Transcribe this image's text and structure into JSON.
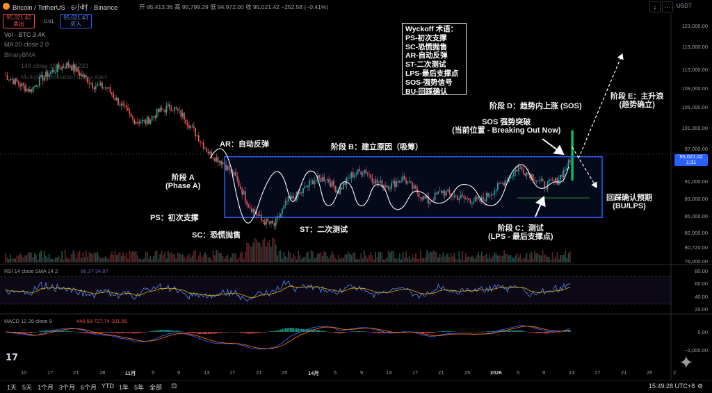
{
  "header": {
    "symbol": "Bitcoin / TetherUS · 6小时 · Binance",
    "ohlc": "开 95,413.36  高 95,799.29  低 94,972.00  收 95,021.42  −252.58 (−0.41%)",
    "sell_price": "95,021.42",
    "sell_label": "卖出",
    "spread": "0.01",
    "buy_price": "95,021.43",
    "buy_label": "买入",
    "quote_currency": "USDT"
  },
  "legends": {
    "volume": "Vol · BTC  3.4K",
    "ma": "MA 20 close 2 0",
    "bbma": "BinaryBMA",
    "ema": "144 close 169 close 233",
    "multi": "Multiple Correlation Cross Alert"
  },
  "wyckoff_legend": {
    "title": "Wyckoff 术语：",
    "items": [
      "PS-初次支撑",
      "SC-恐慌抛售",
      "AR-自动反弹",
      "ST-二次测试",
      "LPS-最后支撑点",
      "SOS-强势信号",
      "BU-回踩确认"
    ]
  },
  "annotations": {
    "ar": "AR：自动反弹",
    "phase_a_1": "阶段 A",
    "phase_a_2": "(Phase A)",
    "ps": "PS：初次支撑",
    "sc": "SC：恐慌抛售",
    "phase_b": "阶段 B：建立原因（吸筹）",
    "st": "ST：二次测试",
    "phase_c_1": "阶段 C：测试",
    "phase_c_2": "(LPS - 最后支撑点)",
    "phase_d": "阶段 D：趋势内上涨 (SOS)",
    "sos_1": "SOS 强势突破",
    "sos_2": "(当前位置 - Breaking Out Now)",
    "phase_e_1": "阶段 E：主升浪",
    "phase_e_2": "(趋势确立)",
    "bu_1": "回踩确认预期",
    "bu_2": "(BU/LPS)"
  },
  "price_axis": {
    "ticks": [
      "123,000.00",
      "119,000.00",
      "113,000.00",
      "109,000.00",
      "105,000.00",
      "101,000.00",
      "97,000.00",
      "91,000.00",
      "89,000.00",
      "85,000.00",
      "82,000.00",
      "80,720.00",
      "76,000.00"
    ],
    "last_price": "95,021.42",
    "countdown": "1:31"
  },
  "rsi": {
    "label": "RSI 14 close SMA 14 2",
    "values_text": "66.37  34.87",
    "ticks": [
      "80.00",
      "60.00",
      "40.00",
      "20.00"
    ]
  },
  "macd": {
    "label": "MACD 12 26 close 9",
    "values_text": "446.93  727.74  301.56",
    "ticks": [
      "0.00",
      "−2,000.00"
    ]
  },
  "time_axis": {
    "labels": [
      "10",
      "17",
      "21",
      "28",
      "11月",
      "5",
      "9",
      "13",
      "17",
      "21",
      "25",
      "14月",
      "5",
      "9",
      "13",
      "17",
      "21",
      "25",
      "2026",
      "5",
      "9",
      "13",
      "17",
      "21",
      "25",
      "2"
    ]
  },
  "bottom_bar": {
    "timeframes": [
      "1天",
      "5天",
      "1个月",
      "3个月",
      "6个月",
      "YTD",
      "1年",
      "5年",
      "全部"
    ],
    "clock": "15:49:28 UTC+8"
  },
  "colors": {
    "up": "#26a69a",
    "down": "#ef5350",
    "box": "#2962ff",
    "rsi": "#7e57c2",
    "macd": "#2962ff",
    "signal": "#ff6d00",
    "lps_line": "#2e7d32",
    "breakout": "#00c853"
  },
  "chart_data": {
    "type": "candlestick",
    "title": "Bitcoin / TetherUS · 6小时 · Binance",
    "x_range": [
      "10月10日",
      "2026年2月"
    ],
    "ylim": [
      76000,
      123000
    ],
    "last_close": 95021.42,
    "change": -252.58,
    "change_pct": -0.41,
    "close_path": [
      {
        "t": 0,
        "close": 111500
      },
      {
        "t": 8,
        "close": 110000
      },
      {
        "t": 16,
        "close": 108500
      },
      {
        "t": 24,
        "close": 111000
      },
      {
        "t": 32,
        "close": 112500
      },
      {
        "t": 40,
        "close": 113500
      },
      {
        "t": 48,
        "close": 111500
      },
      {
        "t": 56,
        "close": 109500
      },
      {
        "t": 64,
        "close": 109000
      },
      {
        "t": 72,
        "close": 106000
      },
      {
        "t": 80,
        "close": 103000
      },
      {
        "t": 88,
        "close": 102500
      },
      {
        "t": 96,
        "close": 104500
      },
      {
        "t": 104,
        "close": 105500
      },
      {
        "t": 112,
        "close": 103500
      },
      {
        "t": 120,
        "close": 100000
      },
      {
        "t": 128,
        "close": 96500
      },
      {
        "t": 136,
        "close": 95000
      },
      {
        "t": 144,
        "close": 92000
      },
      {
        "t": 152,
        "close": 87000
      },
      {
        "t": 160,
        "close": 84000
      },
      {
        "t": 168,
        "close": 83000
      },
      {
        "t": 176,
        "close": 87500
      },
      {
        "t": 184,
        "close": 89000
      },
      {
        "t": 192,
        "close": 91500
      },
      {
        "t": 200,
        "close": 92000
      },
      {
        "t": 208,
        "close": 89500
      },
      {
        "t": 216,
        "close": 92500
      },
      {
        "t": 224,
        "close": 93500
      },
      {
        "t": 232,
        "close": 91000
      },
      {
        "t": 240,
        "close": 90500
      },
      {
        "t": 248,
        "close": 92000
      },
      {
        "t": 256,
        "close": 89500
      },
      {
        "t": 264,
        "close": 87500
      },
      {
        "t": 272,
        "close": 89500
      },
      {
        "t": 280,
        "close": 88500
      },
      {
        "t": 288,
        "close": 88000
      },
      {
        "t": 296,
        "close": 87500
      },
      {
        "t": 304,
        "close": 89500
      },
      {
        "t": 312,
        "close": 91500
      },
      {
        "t": 320,
        "close": 94000
      },
      {
        "t": 328,
        "close": 92500
      },
      {
        "t": 336,
        "close": 90500
      },
      {
        "t": 344,
        "close": 91500
      },
      {
        "t": 352,
        "close": 95021
      }
    ],
    "levels": {
      "range_high": 96000,
      "range_low": 84500,
      "lps": 88200,
      "dotted_resistance": 96500
    },
    "rsi_last": [
      66.37,
      34.87
    ],
    "macd_last": [
      446.93,
      727.74,
      301.56
    ]
  }
}
